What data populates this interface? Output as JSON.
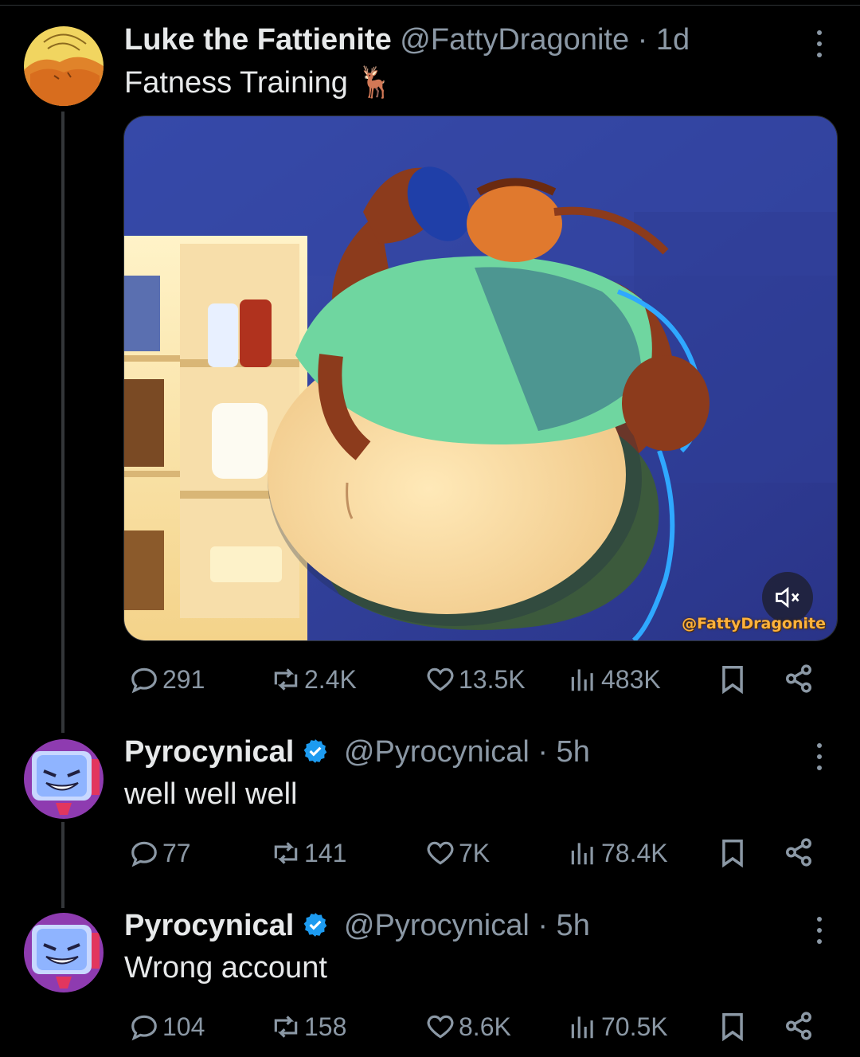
{
  "tweets": [
    {
      "author": "Luke the Fattienite",
      "handle": "@FattyDragonite",
      "time": "· 1d",
      "text": "Fatness Training",
      "emoji": "🦌",
      "media": {
        "watermark": "@FattyDragonite",
        "sound": "muted"
      },
      "stats": {
        "replies": "291",
        "reposts": "2.4K",
        "likes": "13.5K",
        "views": "483K"
      }
    },
    {
      "author": "Pyrocynical",
      "handle": "@Pyrocynical",
      "time": "· 5h",
      "verified": true,
      "text": "well well well",
      "stats": {
        "replies": "77",
        "reposts": "141",
        "likes": "7K",
        "views": "78.4K"
      }
    },
    {
      "author": "Pyrocynical",
      "handle": "@Pyrocynical",
      "time": "· 5h",
      "verified": true,
      "text": "Wrong account",
      "stats": {
        "replies": "104",
        "reposts": "158",
        "likes": "8.6K",
        "views": "70.5K"
      }
    }
  ],
  "icons": [
    "reply-icon",
    "repost-icon",
    "like-icon",
    "views-icon",
    "bookmark-icon",
    "share-icon",
    "more-icon",
    "mute-icon",
    "verified-badge-icon"
  ],
  "colors": {
    "background": "#000000",
    "text": "#e7e9ea",
    "muted": "#8b98a5",
    "verified": "#1d9bf0"
  }
}
